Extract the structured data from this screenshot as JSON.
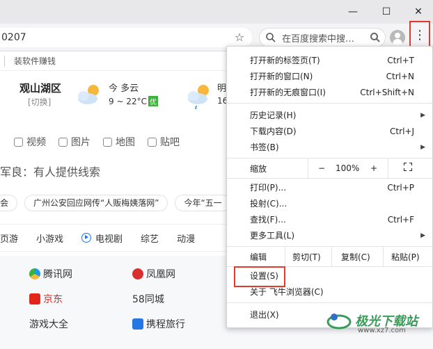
{
  "window": {
    "minimize": "—",
    "maximize": "☐",
    "close": "✕"
  },
  "toolbar": {
    "url_text": "0207",
    "search_placeholder": "在百度搜索中搜…",
    "menu_button": "⋮"
  },
  "page": {
    "ad_text": "装软件赚钱",
    "weather": {
      "city": "观山湖区",
      "switch": "[切换]",
      "day1": "今  多云",
      "temp1": "9 ~ 22°C",
      "badge": "优",
      "day2": "明",
      "temp2": "16"
    },
    "nav": [
      "视频",
      "图片",
      "地图",
      "贴吧"
    ],
    "news": "军良：有人提供线索",
    "tags": [
      "会",
      "广州公安回应网传“人贩梅姨落网”",
      "今年“五一"
    ],
    "cats": [
      "页游",
      "小游戏",
      "电视剧",
      "综艺",
      "动漫"
    ],
    "sites": {
      "row1": [
        "腾讯网",
        "凤凰网"
      ],
      "row2": [
        "京东",
        "58同城"
      ],
      "row3": [
        "游戏大全",
        "携程旅行"
      ]
    }
  },
  "menu": {
    "new_tab": {
      "label": "打开新的标签页(T)",
      "shortcut": "Ctrl+T"
    },
    "new_window": {
      "label": "打开新的窗口(N)",
      "shortcut": "Ctrl+N"
    },
    "incognito": {
      "label": "打开新的无痕窗口(I)",
      "shortcut": "Ctrl+Shift+N"
    },
    "history": {
      "label": "历史记录(H)"
    },
    "downloads": {
      "label": "下载内容(D)",
      "shortcut": "Ctrl+J"
    },
    "bookmarks": {
      "label": "书签(B)"
    },
    "zoom": {
      "label": "缩放",
      "minus": "−",
      "value": "100%",
      "plus": "+"
    },
    "print": {
      "label": "打印(P)...",
      "shortcut": "Ctrl+P"
    },
    "cast": {
      "label": "投射(C)..."
    },
    "find": {
      "label": "查找(F)...",
      "shortcut": "Ctrl+F"
    },
    "more_tools": {
      "label": "更多工具(L)"
    },
    "edit": {
      "label": "编辑",
      "cut": "剪切(T)",
      "copy": "复制(C)",
      "paste": "粘贴(P)"
    },
    "settings": {
      "label": "设置(S)"
    },
    "about": {
      "label": "关于 飞牛浏览器(C)"
    },
    "exit": {
      "label": "退出(X)"
    }
  },
  "watermark": {
    "text": "极光下载站",
    "url": "www.xz7.com"
  },
  "colors": {
    "highlight_box": "#e03a2e",
    "weather_badge": "#3db23a"
  }
}
